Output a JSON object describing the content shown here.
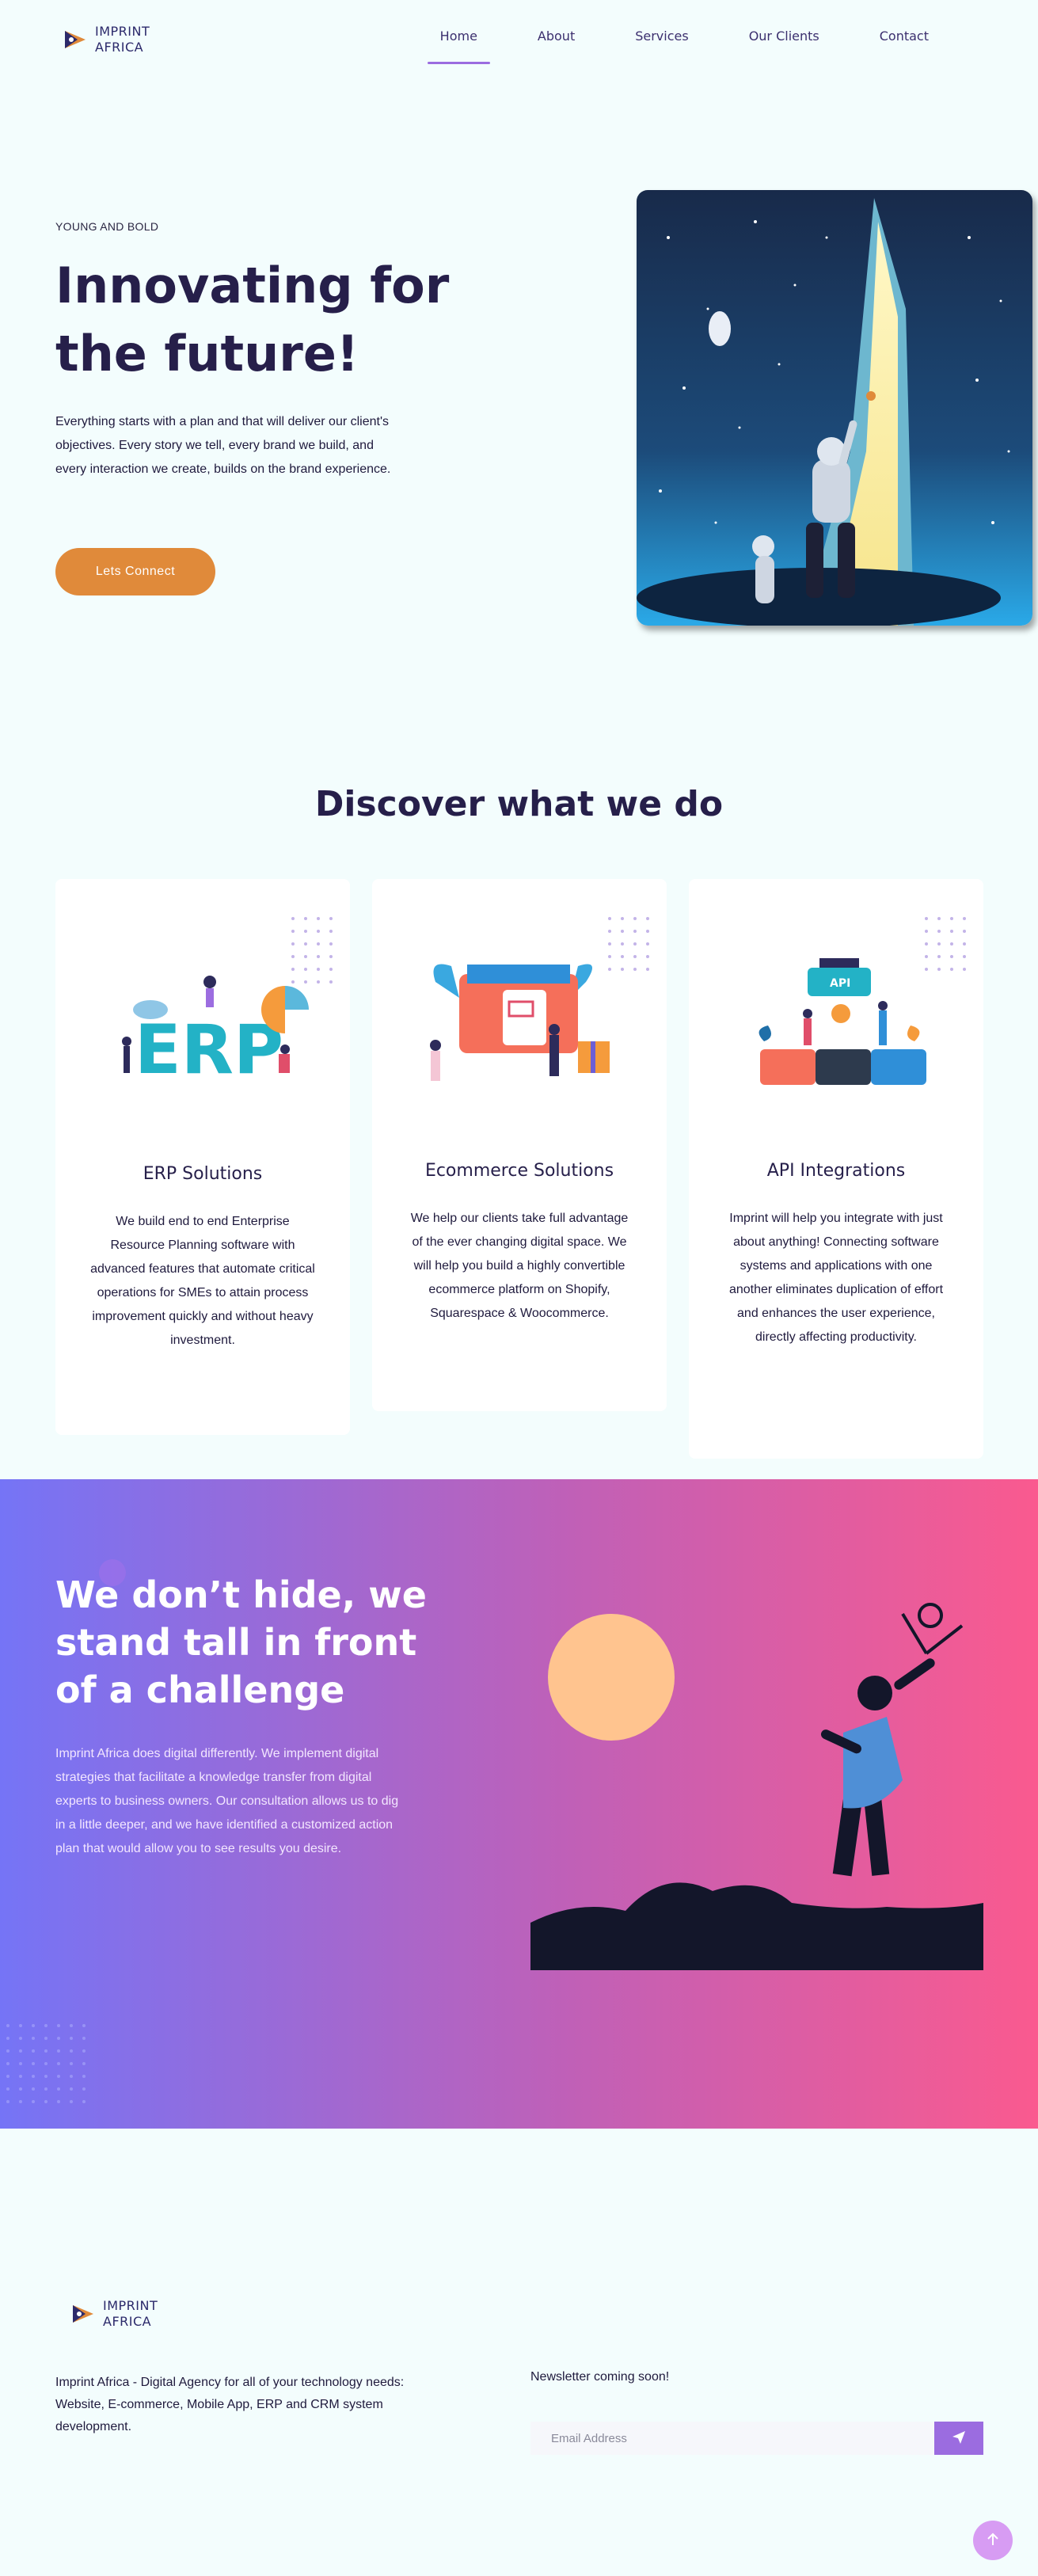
{
  "brand": {
    "line1": "IMPRINT",
    "line2": "AFRICA"
  },
  "nav": {
    "items": [
      {
        "label": "Home",
        "active": true
      },
      {
        "label": "About",
        "active": false
      },
      {
        "label": "Services",
        "active": false
      },
      {
        "label": "Our Clients",
        "active": false
      },
      {
        "label": "Contact",
        "active": false
      }
    ]
  },
  "hero": {
    "kicker": "YOUNG AND BOLD",
    "title": "Innovating for the future!",
    "body": "Everything starts with a plan and that will deliver our client's objectives. Every story we tell, every brand we build, and every interaction we create, builds on the brand experience.",
    "cta": "Lets Connect",
    "image_icon": "astronaut-illustration"
  },
  "services": {
    "title": "Discover what we do",
    "cards": [
      {
        "art_label": "ERP",
        "title": "ERP Solutions",
        "body": "We build end to end Enterprise Resource Planning software with advanced features that automate critical operations for SMEs to attain process improvement quickly and without heavy investment."
      },
      {
        "art_label": "",
        "title": "Ecommerce Solutions",
        "body": "We help our clients take full advantage of the ever changing digital space. We will help you build a highly convertible ecommerce platform on Shopify, Squarespace & Woocommerce."
      },
      {
        "art_label": "API",
        "title": "API Integrations",
        "body": "Imprint will help you integrate with just about anything! Connecting software systems and applications with one another eliminates duplication of effort and enhances the user experience, directly affecting productivity."
      }
    ]
  },
  "banner": {
    "title": "We don’t hide, we stand tall in front of a challenge",
    "body": "Imprint Africa does digital differently. We implement digital strategies that facilitate a knowledge transfer from digital experts to business owners. Our consultation allows us to dig in a little deeper, and we have identified a customized action plan that would allow you to see results you desire.",
    "image_icon": "slingshot-figure-illustration"
  },
  "footer": {
    "description": "Imprint Africa - Digital Agency for all of your technology needs: Website, E-commerce, Mobile App, ERP and CRM system development.",
    "newsletter_label": "Newsletter coming soon!",
    "email_placeholder": "Email Address",
    "send_icon": "paper-plane-icon",
    "top_icon": "arrow-up-icon"
  },
  "colors": {
    "accent": "#9b6ce0",
    "cta": "#e08a3a",
    "heading": "#261f4a",
    "gradient_start": "#7574f6",
    "gradient_end": "#fa5a8f"
  }
}
